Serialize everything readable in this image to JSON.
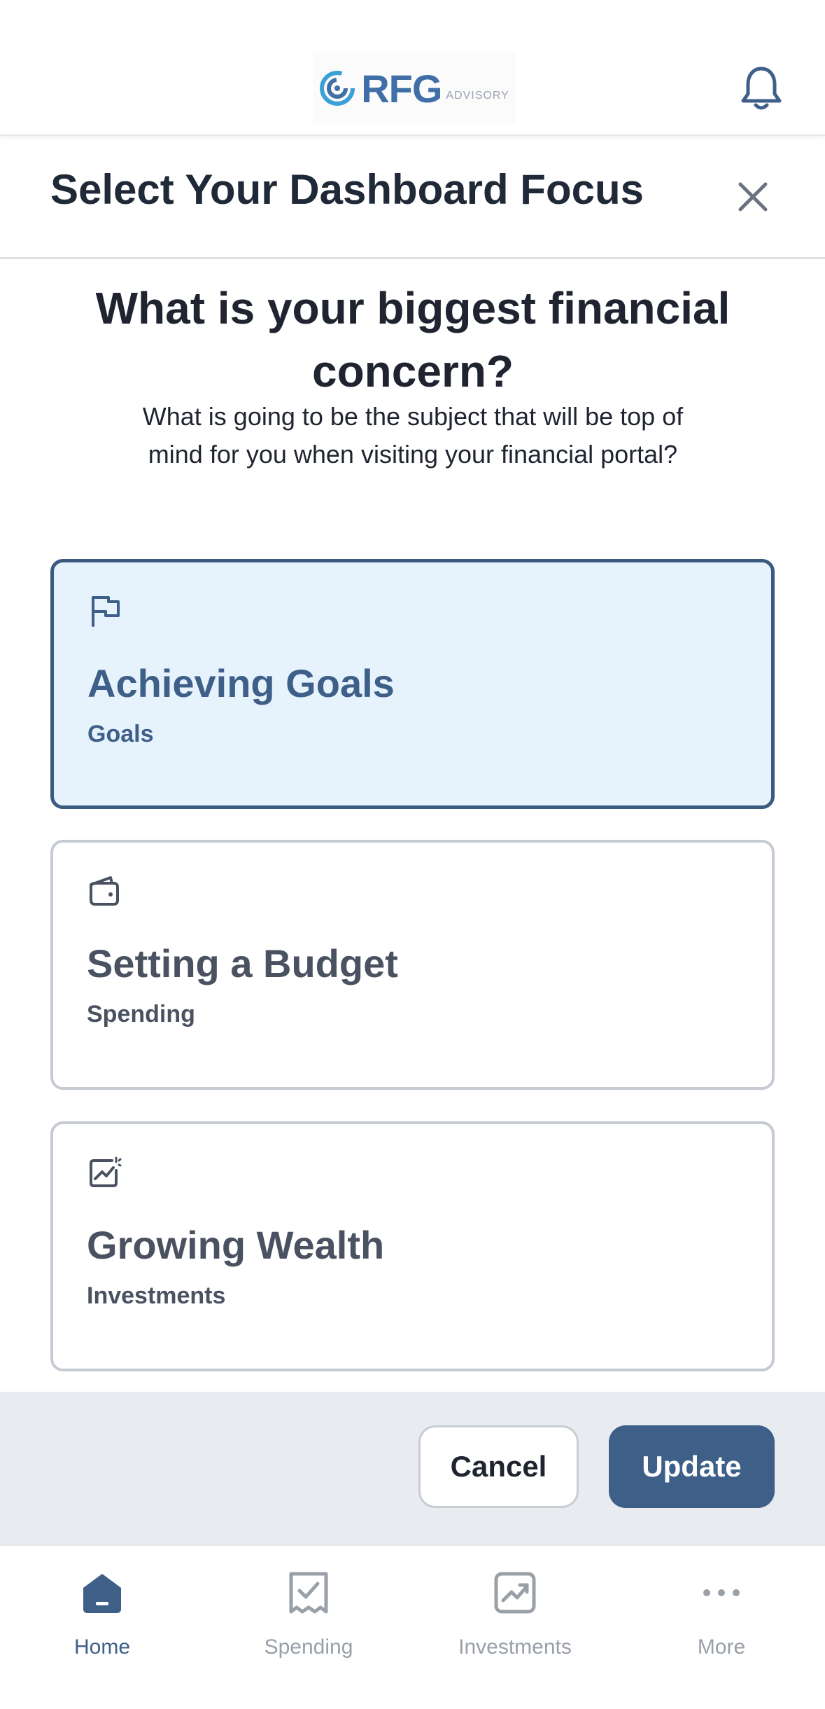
{
  "header": {
    "logo_text": "RFG",
    "logo_sub": "ADVISORY",
    "notifications_icon": "bell-icon"
  },
  "sheet": {
    "title": "Select Your Dashboard Focus",
    "close_icon": "close-icon"
  },
  "question": {
    "title": "What is your biggest financial concern?",
    "subtitle": "What is going to be the subject that will be top of mind for you when visiting your financial portal?"
  },
  "options": [
    {
      "title": "Achieving Goals",
      "subtitle": "Goals",
      "icon": "flag-icon",
      "selected": true
    },
    {
      "title": "Setting a Budget",
      "subtitle": "Spending",
      "icon": "wallet-icon",
      "selected": false
    },
    {
      "title": "Growing Wealth",
      "subtitle": "Investments",
      "icon": "chart-growth-icon",
      "selected": false
    }
  ],
  "actions": {
    "cancel_label": "Cancel",
    "update_label": "Update"
  },
  "nav": {
    "items": [
      {
        "label": "Home",
        "icon": "home-icon",
        "active": true
      },
      {
        "label": "Spending",
        "icon": "receipt-check-icon",
        "active": false
      },
      {
        "label": "Investments",
        "icon": "chart-growth-icon",
        "active": false
      },
      {
        "label": "More",
        "icon": "more-dots-icon",
        "active": false
      }
    ]
  },
  "colors": {
    "primary": "#3e5f87",
    "selected_bg": "#e6f2fc",
    "inactive": "#9aa0a8",
    "action_bar_bg": "#e8ebf0"
  }
}
